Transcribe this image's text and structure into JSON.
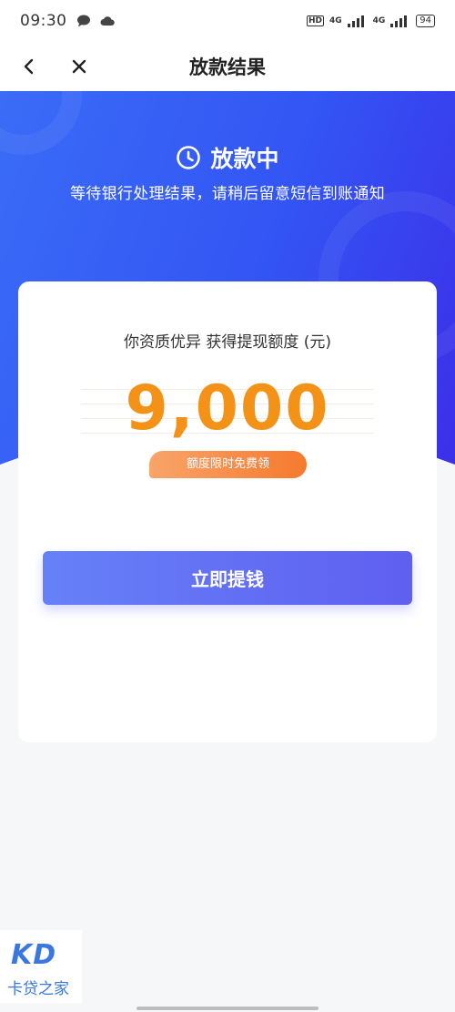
{
  "status_bar": {
    "time": "09:30",
    "hd_label": "HD",
    "network_1": "4G",
    "network_2": "4G",
    "battery": "94"
  },
  "nav": {
    "title": "放款结果",
    "back_icon": "chevron-left-icon",
    "close_icon": "close-icon"
  },
  "hero": {
    "status_icon": "clock-icon",
    "status_text": "放款中",
    "subtitle": "等待银行处理结果，请稍后留意短信到账通知"
  },
  "card": {
    "label": "你资质优异 获得提现额度 (元)",
    "amount": "9,000",
    "promo_badge": "额度限时免费领",
    "withdraw_button": "立即提钱"
  },
  "watermark": {
    "logo": "KD",
    "text": "卡贷之家"
  },
  "colors": {
    "hero_blue": "#3355f4",
    "amount_orange": "#f39216",
    "button_purple": "#5f5ff0"
  }
}
